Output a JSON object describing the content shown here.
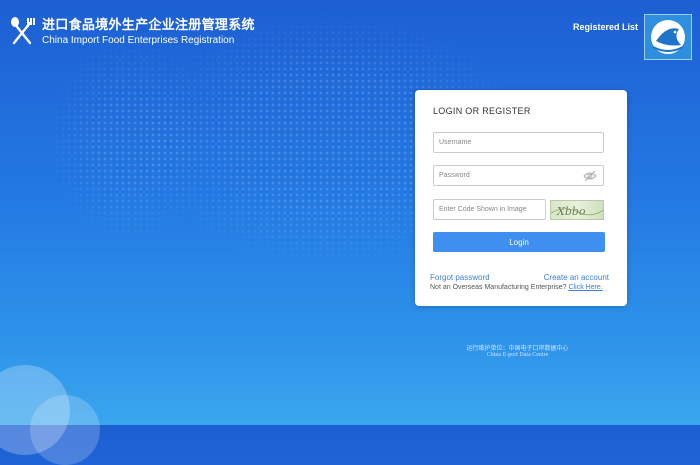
{
  "header": {
    "title_cn": "进口食品境外生产企业注册管理系统",
    "title_en": "China Import Food Enterprises Registration",
    "registered_list": "Registered List",
    "logo_icon": "fork-spoon-icon",
    "corner_icon": "fish-icon"
  },
  "login": {
    "title": "LOGIN OR REGISTER",
    "username_placeholder": "Username",
    "password_placeholder": "Password",
    "captcha_placeholder": "Enter Code Shown in Image",
    "captcha_text": "Xbbo",
    "login_button": "Login",
    "forgot_password": "Forgot password",
    "create_account": "Create an account",
    "notice": "Not an Overseas Manufacturing Enterprise?",
    "click_here": "Click Here."
  },
  "footer": {
    "operator_cn": "运行维护单位：中国电子口岸数据中心",
    "operator_en": "China E-port Data Centre"
  },
  "colors": {
    "background_top": "#1d5fd3",
    "background_bottom": "#3aa6ee",
    "button": "#3e8ff0",
    "link": "#3a7fd8"
  }
}
